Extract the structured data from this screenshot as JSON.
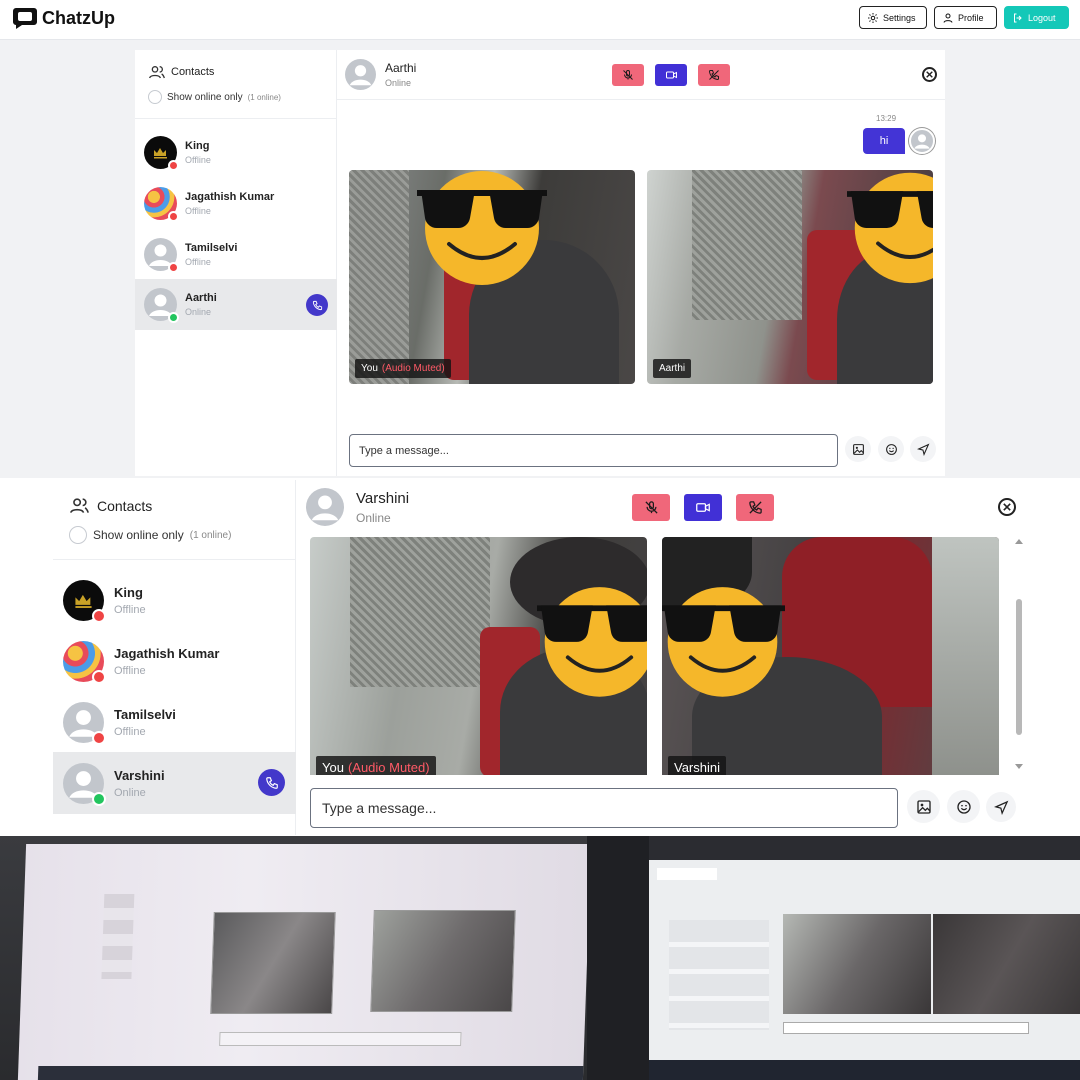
{
  "app": {
    "brand": "ChatzUp"
  },
  "nav": {
    "settings": "Settings",
    "profile": "Profile",
    "logout": "Logout"
  },
  "contacts_panel": {
    "title": "Contacts",
    "show_online_label": "Show online only",
    "online_count": "(1 online)",
    "contacts": [
      {
        "name": "King",
        "status": "Offline"
      },
      {
        "name": "Jagathish Kumar",
        "status": "Offline"
      },
      {
        "name": "Tamilselvi",
        "status": "Offline"
      }
    ]
  },
  "top_call": {
    "active_contact": {
      "name": "Aarthi",
      "status": "Online"
    },
    "message": {
      "time": "13:29",
      "text": "hi"
    },
    "local_label": "You",
    "muted_label": "(Audio Muted)",
    "remote_label": "Aarthi",
    "input_placeholder": "Type a message..."
  },
  "bottom_call": {
    "active_contact": {
      "name": "Varshini",
      "status": "Online"
    },
    "local_label": "You",
    "muted_label": "(Audio Muted)",
    "remote_label": "Varshini",
    "input_placeholder": "Type a message..."
  },
  "icons": [
    "chat-bubble-icon",
    "gear-icon",
    "user-icon",
    "logout-icon",
    "users-icon",
    "mic-off-icon",
    "video-icon",
    "phone-off-icon",
    "close-icon",
    "image-icon",
    "smile-icon",
    "send-icon",
    "phone-call-icon"
  ],
  "colors": {
    "accent_teal": "#14c8b8",
    "mute_pink": "#f0677a",
    "video_blue": "#4130d6",
    "offline_red": "#ef4444",
    "online_green": "#22c55e",
    "badge_indigo": "#4338ca"
  }
}
